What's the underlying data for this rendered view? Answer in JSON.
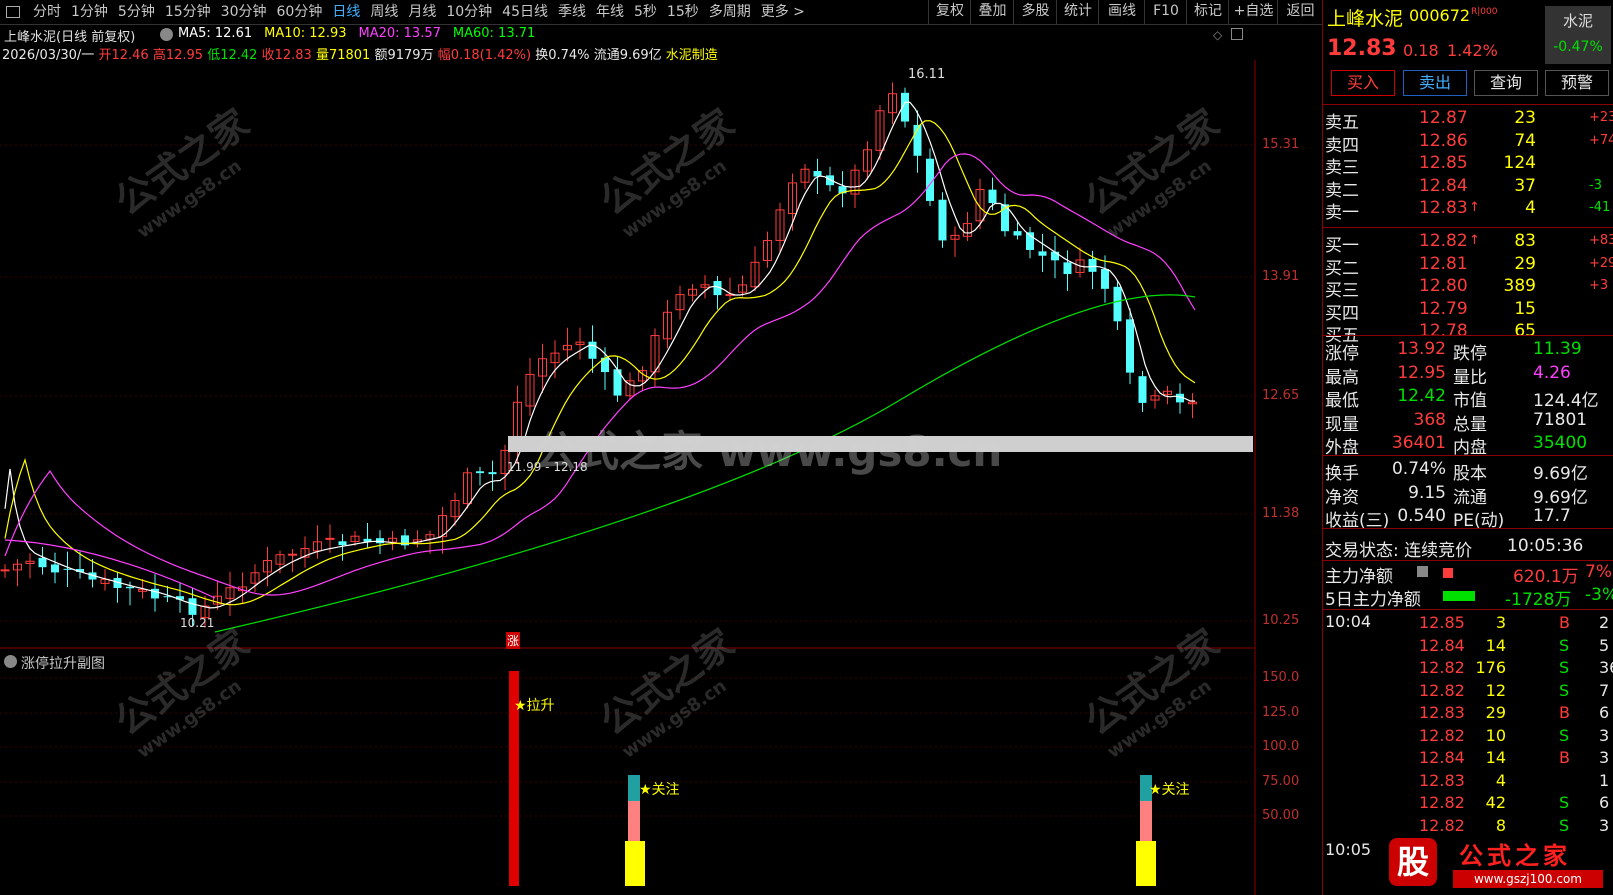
{
  "toolbar": {
    "periods": [
      "分时",
      "1分钟",
      "5分钟",
      "15分钟",
      "30分钟",
      "60分钟",
      "日线",
      "周线",
      "月线",
      "10分钟",
      "45日线",
      "季线",
      "年线",
      "5秒",
      "15秒",
      "多周期",
      "更多 >"
    ],
    "active_period": "日线",
    "right_buttons": [
      "复权",
      "叠加",
      "多股",
      "统计",
      "画线",
      "F10",
      "标记",
      "+自选",
      "返回"
    ]
  },
  "chart": {
    "title": "上峰水泥(日线 前复权)",
    "ma_labels": [
      {
        "text": "MA5: 12.61",
        "color": "#ffffff"
      },
      {
        "text": "MA10: 12.93",
        "color": "#ffff00"
      },
      {
        "text": "MA20: 13.57",
        "color": "#ff40ff"
      },
      {
        "text": "MA60: 13.71",
        "color": "#00ff00"
      }
    ],
    "date": "2026/03/30/一",
    "open_label": "开",
    "open": "12.46",
    "high_label": "高",
    "high": "12.95",
    "low_label": "低",
    "low": "12.42",
    "close_label": "收",
    "close": "12.83",
    "volume": "量71801",
    "amount": "额9179万",
    "change_label": "幅",
    "change": "0.18(1.42%)",
    "turnover": "换0.74%",
    "float": "流通9.69亿",
    "industry": "水泥制造",
    "price_axis": [
      "15.31",
      "13.91",
      "12.65",
      "11.38",
      "10.25"
    ],
    "max_marker": "16.11",
    "min_marker": "10.21",
    "range_label": "11.99 - 12.18",
    "limit_up_tag": "涨",
    "watermark_center": "公式之家 www.gs8.cn"
  },
  "sub": {
    "title": "涨停拉升副图",
    "axis": [
      "150.0",
      "125.0",
      "100.0",
      "75.00",
      "50.00"
    ],
    "labels": [
      "★拉升",
      "★关注",
      "★关注"
    ]
  },
  "watermarks": {
    "cn": "公式之家",
    "url": "www.gs8.cn"
  },
  "panel": {
    "name": "上峰水泥",
    "code": "000672",
    "flag": "R|000",
    "sector": "水泥",
    "sector_change": "-0.47%",
    "price": "12.83",
    "change": "0.18",
    "change_pct": "1.42%",
    "buttons": [
      "买入",
      "卖出",
      "查询",
      "预警"
    ],
    "asks": [
      {
        "label": "卖五",
        "price": "12.87",
        "vol": "23",
        "delta": "+23",
        "arrow": ""
      },
      {
        "label": "卖四",
        "price": "12.86",
        "vol": "74",
        "delta": "+74",
        "arrow": ""
      },
      {
        "label": "卖三",
        "price": "12.85",
        "vol": "124",
        "delta": "",
        "arrow": ""
      },
      {
        "label": "卖二",
        "price": "12.84",
        "vol": "37",
        "delta": "-3",
        "arrow": ""
      },
      {
        "label": "卖一",
        "price": "12.83",
        "vol": "4",
        "delta": "-41",
        "arrow": "↑"
      }
    ],
    "bids": [
      {
        "label": "买一",
        "price": "12.82",
        "vol": "83",
        "delta": "+83",
        "arrow": "↑"
      },
      {
        "label": "买二",
        "price": "12.81",
        "vol": "29",
        "delta": "+29",
        "arrow": ""
      },
      {
        "label": "买三",
        "price": "12.80",
        "vol": "389",
        "delta": "+3",
        "arrow": ""
      },
      {
        "label": "买四",
        "price": "12.79",
        "vol": "15",
        "delta": "",
        "arrow": ""
      },
      {
        "label": "买五",
        "price": "12.78",
        "vol": "65",
        "delta": "",
        "arrow": ""
      }
    ],
    "stats": [
      {
        "l1": "涨停",
        "v1": "13.92",
        "c1": "red",
        "l2": "跌停",
        "v2": "11.39",
        "c2": "green"
      },
      {
        "l1": "最高",
        "v1": "12.95",
        "c1": "red",
        "l2": "量比",
        "v2": "4.26",
        "c2": "magenta"
      },
      {
        "l1": "最低",
        "v1": "12.42",
        "c1": "green",
        "l2": "市值",
        "v2": "124.4亿",
        "c2": "white"
      },
      {
        "l1": "现量",
        "v1": "368",
        "c1": "red",
        "l2": "总量",
        "v2": "71801",
        "c2": "white"
      },
      {
        "l1": "外盘",
        "v1": "36401",
        "c1": "red",
        "l2": "内盘",
        "v2": "35400",
        "c2": "green"
      }
    ],
    "stats2": [
      {
        "l1": "换手",
        "v1": "0.74%",
        "l2": "股本",
        "v2": "9.69亿"
      },
      {
        "l1": "净资",
        "v1": "9.15",
        "l2": "流通",
        "v2": "9.69亿"
      },
      {
        "l1": "收益(三)",
        "v1": "0.540",
        "l2": "PE(动)",
        "v2": "17.7"
      }
    ],
    "trade_status": "交易状态: 连续竞价",
    "trade_time": "10:05:36",
    "main_net_label": "主力净额",
    "main_net": "620.1万",
    "main_net_pct": "7%",
    "main5_label": "5日主力净额",
    "main5": "-1728万",
    "main5_pct": "-3%",
    "ticks_time1": "10:04",
    "ticks": [
      {
        "p": "12.85",
        "v": "3",
        "s": "B",
        "n": "2"
      },
      {
        "p": "12.84",
        "v": "14",
        "s": "S",
        "n": "5"
      },
      {
        "p": "12.82",
        "v": "176",
        "s": "S",
        "n": "36"
      },
      {
        "p": "12.82",
        "v": "12",
        "s": "S",
        "n": "7"
      },
      {
        "p": "12.83",
        "v": "29",
        "s": "B",
        "n": "6"
      },
      {
        "p": "12.82",
        "v": "10",
        "s": "S",
        "n": "3"
      },
      {
        "p": "12.84",
        "v": "14",
        "s": "B",
        "n": "3"
      },
      {
        "p": "12.83",
        "v": "4",
        "s": "",
        "n": "1"
      },
      {
        "p": "12.82",
        "v": "42",
        "s": "S",
        "n": "6"
      },
      {
        "p": "12.82",
        "v": "8",
        "s": "S",
        "n": "3"
      }
    ],
    "ticks_time2": "10:05",
    "logo_text": "公式之家",
    "logo_url": "www.gszj100.com"
  }
}
